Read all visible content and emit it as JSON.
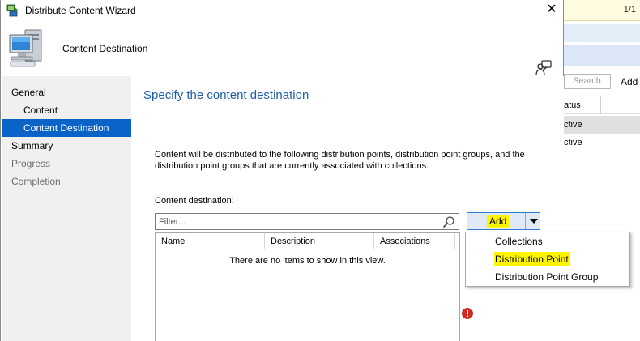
{
  "window": {
    "title": "Distribute Content Wizard",
    "banner_title": "Content Destination"
  },
  "sidebar": {
    "items": [
      {
        "label": "General",
        "level": 1,
        "state": "normal"
      },
      {
        "label": "Content",
        "level": 2,
        "state": "normal"
      },
      {
        "label": "Content Destination",
        "level": 2,
        "state": "active"
      },
      {
        "label": "Summary",
        "level": 1,
        "state": "normal"
      },
      {
        "label": "Progress",
        "level": 1,
        "state": "disabled"
      },
      {
        "label": "Completion",
        "level": 1,
        "state": "disabled"
      }
    ]
  },
  "main": {
    "heading": "Specify the content destination",
    "description": "Content will be distributed to the following distribution points, distribution point groups, and the distribution point groups that are currently associated with collections.",
    "destination_label": "Content destination:",
    "filter_placeholder": "Filter...",
    "columns": [
      "Name",
      "Description",
      "Associations"
    ],
    "empty_message": "There are no items to show in this view.",
    "add_button": "Add"
  },
  "add_menu": {
    "items": [
      {
        "label": "Collections",
        "highlighted": false
      },
      {
        "label": "Distribution Point",
        "highlighted": true
      },
      {
        "label": "Distribution Point Group",
        "highlighted": false
      }
    ],
    "highlight_color": "#fff500"
  },
  "background_window": {
    "page_indicator": "1/1",
    "search_label": "Search",
    "add_label": "Add",
    "column_fragment": "atus",
    "rows": [
      "ctive",
      "ctive"
    ]
  },
  "colors": {
    "accent": "#0a64c8",
    "heading": "#1f5fa8",
    "sidebar_bg": "#f0f0f0",
    "error": "#d9281e"
  }
}
